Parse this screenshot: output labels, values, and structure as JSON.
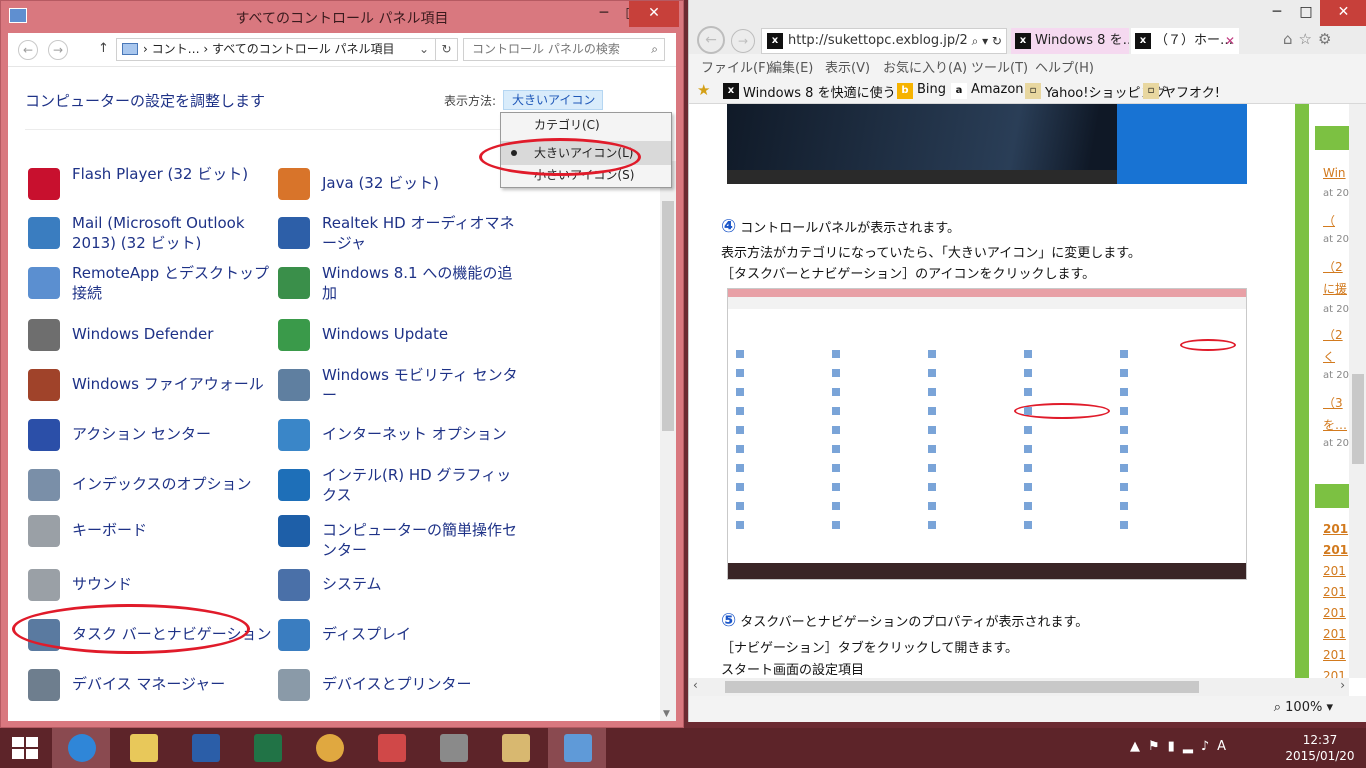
{
  "control_panel": {
    "title": "すべてのコントロール パネル項目",
    "address": "› コント… › すべてのコントロール パネル項目",
    "search_placeholder": "コントロール パネルの検索",
    "heading": "コンピューターの設定を調整します",
    "view_by_label": "表示方法:",
    "view_by_value": "大きいアイコン ▾",
    "dropdown": [
      "カテゴリ(C)",
      "大きいアイコン(L)",
      "小さいアイコン(S)"
    ],
    "items_left": [
      "Flash Player (32 ビット)",
      "Mail (Microsoft Outlook 2013) (32 ビット)",
      "RemoteApp とデスクトップ接続",
      "Windows Defender",
      "Windows ファイアウォール",
      "アクション センター",
      "インデックスのオプション",
      "キーボード",
      "サウンド",
      "タスク バーとナビゲーション",
      "デバイス マネージャー"
    ],
    "items_right": [
      "Java (32 ビット)",
      "Realtek HD オーディオマネージャ",
      "Windows 8.1 への機能の追加",
      "Windows Update",
      "Windows モビリティ センター",
      "インターネット オプション",
      "インテル(R) HD グラフィックス",
      "コンピューターの簡単操作センター",
      "システム",
      "ディスプレイ",
      "デバイスとプリンター"
    ],
    "icon_colors_left": [
      "#c8102e",
      "#3a7dc0",
      "#5b8fd0",
      "#6e6e6e",
      "#a0432a",
      "#2b4fa8",
      "#7a8fa8",
      "#9aa0a6",
      "#9aa0a6",
      "#5a7aa0",
      "#6e7e8e"
    ],
    "icon_colors_right": [
      "#d8742a",
      "#2d5fa8",
      "#3a8f4a",
      "#3a9a4a",
      "#5f7fa0",
      "#3a86c8",
      "#1e6fb8",
      "#1e5fa8",
      "#4a70a8",
      "#3a7dc0",
      "#8a9aa8"
    ]
  },
  "ie": {
    "url": "http://sukettopc.exblog.jp/2",
    "url_controls": "⌕ ▾ ↻",
    "tab1": "Windows 8 を…",
    "tab2": "（７）ホー…",
    "tools": "⌂☆⚙",
    "menus": [
      "ファイル(F)",
      "編集(E)",
      "表示(V)",
      "お気に入り(A)",
      "ツール(T)",
      "ヘルプ(H)"
    ],
    "favorites": [
      "Windows 8 を快適に使う…",
      "Bing",
      "Amazon",
      "Yahoo!ショッピング",
      "ヤフオク!"
    ],
    "step4_num": "④",
    "step4_text": "コントロールパネルが表示されます。",
    "para1": "表示方法がカテゴリになっていたら、「大きいアイコン」に変更します。",
    "para2": "［タスクバーとナビゲーション］のアイコンをクリックします。",
    "step5_num": "⑤",
    "step5_text": "タスクバーとナビゲーションのプロパティが表示されます。",
    "para3": "［ナビゲーション］タブをクリックして開きます。",
    "para4": "スタート画面の設定項目",
    "zoom": "100%",
    "side_links": [
      "Win",
      "（",
      "（2",
      "に援",
      "（2",
      "く",
      "（3",
      "を…"
    ],
    "side_at": [
      "at 20",
      "at 20",
      "at 20",
      "at 20",
      "at 20"
    ],
    "side_years": [
      "201",
      "201",
      "201",
      "201",
      "201",
      "201",
      "201",
      "201"
    ]
  },
  "taskbar": {
    "time": "12:37",
    "date": "2015/01/20",
    "ime": "A"
  }
}
